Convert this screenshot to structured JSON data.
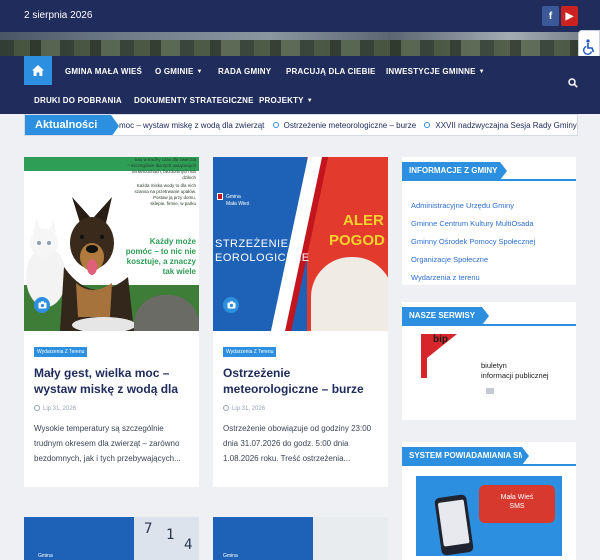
{
  "topbar": {
    "date": "2 sierpnia 2026",
    "social": [
      {
        "name": "facebook-icon",
        "glyph": "f"
      },
      {
        "name": "youtube-icon",
        "glyph": "▶"
      }
    ]
  },
  "nav": {
    "items": [
      {
        "label": "GMINA MAŁA WIEŚ",
        "caret": false
      },
      {
        "label": "O GMINIE",
        "caret": true
      },
      {
        "label": "RADA GMINY",
        "caret": false
      },
      {
        "label": "PRACUJĄ DLA CIEBIE",
        "caret": false
      },
      {
        "label": "INWESTYCJE GMINNE",
        "caret": true
      },
      {
        "label": "DRUKI DO POBRANIA",
        "caret": false
      },
      {
        "label": "DOKUMENTY STRATEGICZNE",
        "caret": false
      },
      {
        "label": "PROJEKTY",
        "caret": true
      }
    ]
  },
  "ticker": {
    "label": "Aktualności",
    "items": [
      "moc – wystaw miskę z wodą dla zwierząt",
      "Ostrzeżenie meteorologiczne – burze",
      "XXVII nadzwyczajna Sesja Rady Gminy Mała Wieś"
    ]
  },
  "posts": [
    {
      "category": "Wydarzenia Z Terenu",
      "title": "Mały gest, wielka moc – wystaw miskę z wodą dla",
      "date": "Lip 31, 2026",
      "excerpt": "Wysokie temperatury są szczególnie trudnym okresem dla zwierząt – zarówno bezdomnych, jak i tych przebywających...",
      "image": {
        "lines_top": [
          "tutu w trudny czas dla zwierząt",
          "– szczególnie dla tych uwiązanych",
          "na łańcuchach, bezdomnych lub dzikich"
        ],
        "lines_mid": [
          "Każda miska wody to dla nich",
          "szansa na przetrwanie upałów.",
          "Postaw ją przy domu,",
          "sklepie, firmie, w parku"
        ],
        "slogan": "Każdy może pomóc – to nic nie kosztuje, a znaczy tak wiele"
      }
    },
    {
      "category": "Wydarzenia Z Terenu",
      "title": "Ostrzeżenie meteorologiczne – burze",
      "date": "Lip 31, 2026",
      "excerpt": "Ostrzeżenie obowiązuje od godziny 23:00 dnia 31.07.2026 do godz. 5:00 dnia 1.08.2026 roku. Treść ostrzeżenia...",
      "image": {
        "logo_lines": [
          "Gmina",
          "Mała Wieś"
        ],
        "title_lines": [
          "STRZEŻENIE",
          "EOROLOGICZNE"
        ],
        "alert_lines": [
          "ALER",
          "POGOD"
        ]
      }
    }
  ],
  "bottom_cards": [
    {
      "logo": "Gmina",
      "digits": [
        "7",
        "1",
        "4"
      ]
    },
    {
      "logo": "Gmina"
    }
  ],
  "sidebar": {
    "info": {
      "title": "INFORMACJE Z GMINY",
      "links": [
        "Administracyjne Urzędu Gminy",
        "Gminne Centrum Kultury MultiOsada",
        "Gminny Ośrodek Pomocy Społecznej",
        "Organizacje Społeczne",
        "Wydarzenia z terenu"
      ]
    },
    "services": {
      "title": "NASZE SERWISY",
      "bip_mark": "bip",
      "bip_lines": [
        "biuletyn",
        "informacji publicznej"
      ]
    },
    "sms": {
      "title": "SYSTEM POWIADAMIANIA SMS",
      "bubble_lines": [
        "Mała Wieś",
        "SMS"
      ]
    }
  },
  "colors": {
    "navy": "#202c5c",
    "accent": "#2d8fe0",
    "link": "#2d6fd0"
  }
}
